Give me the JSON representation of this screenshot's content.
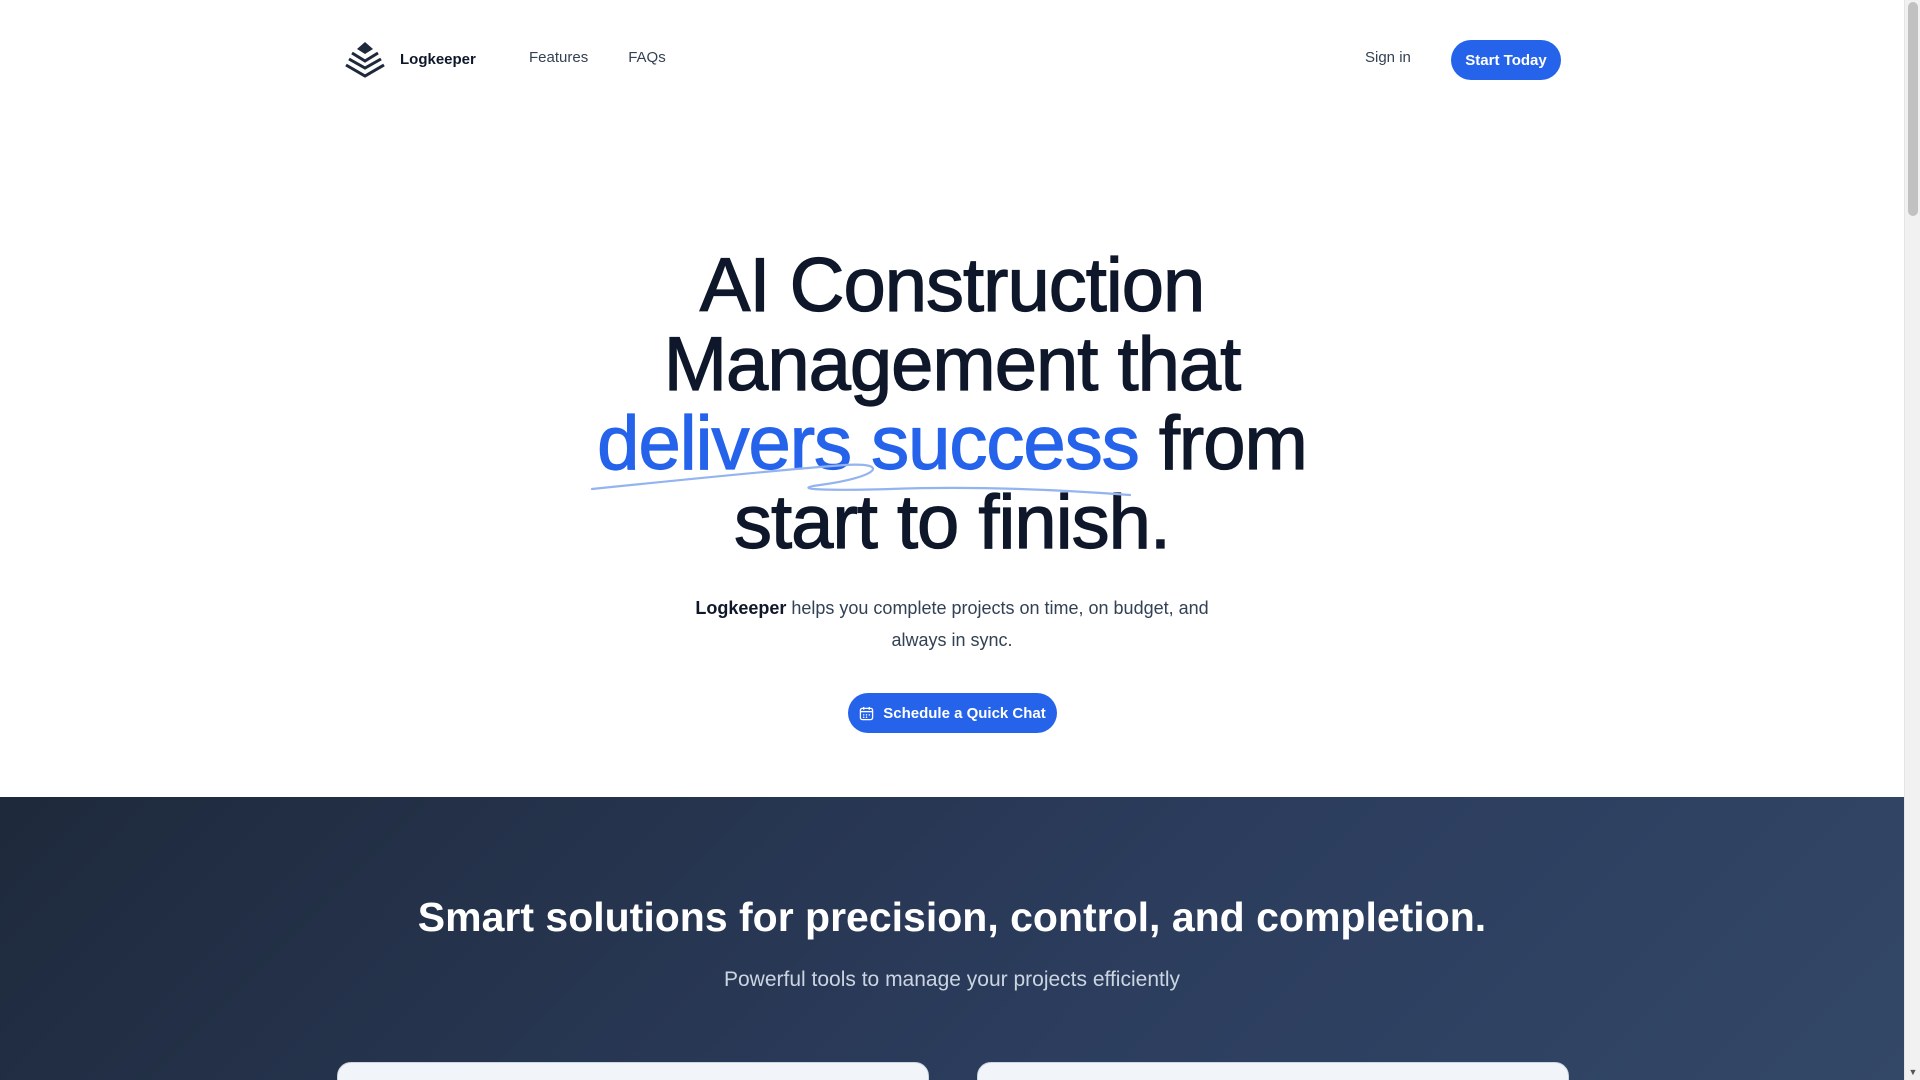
{
  "header": {
    "brand": "Logkeeper",
    "logo_icon": "layered-pyramid-icon",
    "nav": [
      {
        "label": "Features"
      },
      {
        "label": "FAQs"
      }
    ],
    "signin_label": "Sign in",
    "cta_label": "Start Today"
  },
  "hero": {
    "title_line1": "AI Construction",
    "title_line2": "Management that",
    "title_accent": "delivers success",
    "title_line3_rest": " from",
    "title_line4": "start to finish.",
    "sub_brand": "Logkeeper",
    "sub_text": " helps you complete projects on time, on budget, and always in sync.",
    "cta_label": "Schedule a Quick Chat",
    "cta_icon": "calendar-icon"
  },
  "features": {
    "title": "Smart solutions for precision, control, and completion.",
    "subtitle": "Powerful tools to manage your projects efficiently"
  },
  "colors": {
    "accent": "#2563eb",
    "dark_section": "#1e293b",
    "text": "#0f172a"
  }
}
